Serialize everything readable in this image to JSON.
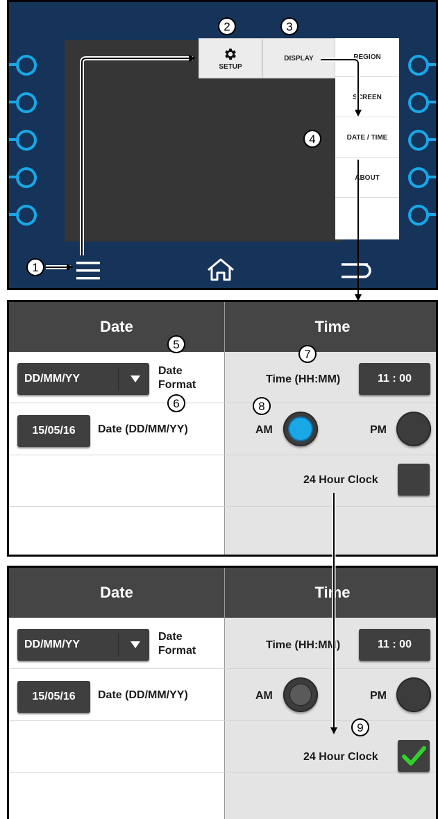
{
  "device": {
    "menu": {
      "setup_label": "SETUP",
      "display_label": "DISPLAY"
    },
    "submenu": [
      "REGION",
      "SCREEN",
      "DATE / TIME",
      "ABOUT"
    ]
  },
  "callouts": [
    "1",
    "2",
    "3",
    "4",
    "5",
    "6",
    "7",
    "8",
    "9"
  ],
  "panel_before": {
    "date_header": "Date",
    "time_header": "Time",
    "date_format_value": "DD/MM/YY",
    "date_format_label": "Date\nFormat",
    "date_value": "15/05/16",
    "date_label": "Date (DD/MM/YY)",
    "time_label": "Time (HH:MM)",
    "time_value": "11 : 00",
    "am_label": "AM",
    "pm_label": "PM",
    "clock24_label": "24 Hour Clock",
    "am_selected": true,
    "clock24_checked": false
  },
  "panel_after": {
    "date_header": "Date",
    "time_header": "Time",
    "date_format_value": "DD/MM/YY",
    "date_format_label": "Date\nFormat",
    "date_value": "15/05/16",
    "date_label": "Date (DD/MM/YY)",
    "time_label": "Time (HH:MM)",
    "time_value": "11 : 00",
    "am_label": "AM",
    "pm_label": "PM",
    "clock24_label": "24 Hour Clock",
    "am_selected": false,
    "clock24_checked": true
  },
  "colors": {
    "accent_blue": "#19a7e6",
    "check_green": "#2fd12a",
    "device_bg": "#16345a"
  }
}
